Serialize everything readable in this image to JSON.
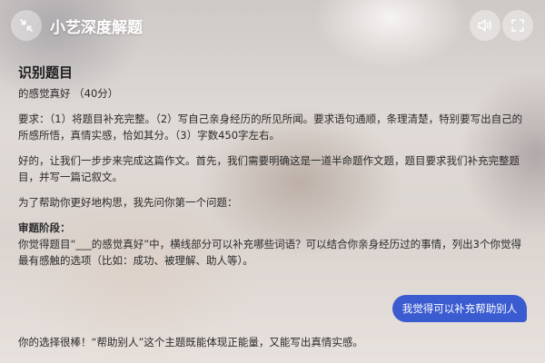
{
  "header": {
    "title": "小艺深度解题",
    "icons": {
      "collapse": "collapse-icon",
      "sound": "speaker-icon",
      "fullscreen": "fullscreen-icon"
    }
  },
  "question": {
    "title": "识别题目",
    "subtitle": "的感觉真好 （40分）",
    "requirement": "要求：（1）将题目补充完整。（2）写自己亲身经历的所见所闻。要求语句通顺，条理清楚，特别要写出自己的所感所悟，真情实感，恰如其分。（3）字数450字左右。"
  },
  "assistant": {
    "intro": "好的，让我们一步步来完成这篇作文。首先，我们需要明确这是一道半命题作文题，题目要求我们补充完整题目，并写一篇记叙文。",
    "lead": "为了帮助你更好地构思，我先问你第一个问题：",
    "stage_label": "审题阶段：",
    "stage_question": "你觉得题目“___的感觉真好”中，横线部分可以补充哪些词语？可以结合你亲身经历过的事情，列出3个你觉得最有感触的选项（比如：成功、被理解、助人等）。"
  },
  "user_message": "我觉得可以补充帮助别人",
  "reply": "你的选择很棒！“帮助别人”这个主题既能体现正能量，又能写出真情实感。",
  "colors": {
    "bubble": "#3b5bd0",
    "header_text": "#ffffff"
  }
}
